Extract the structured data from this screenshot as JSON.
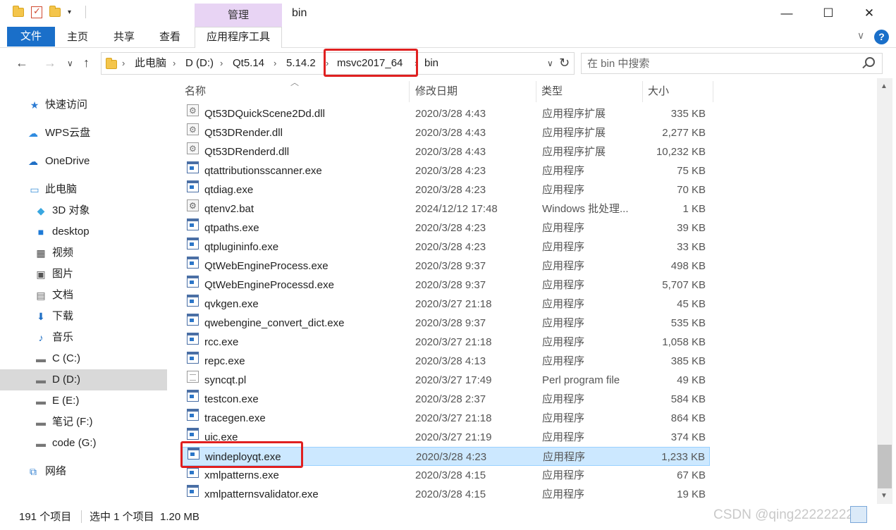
{
  "window": {
    "title": "bin",
    "contextual_group": "管理",
    "controls": {
      "minimize": "—",
      "maximize": "☐",
      "close": "✕"
    }
  },
  "ribbon": {
    "tabs": {
      "file": "文件",
      "home": "主页",
      "share": "共享",
      "view": "查看",
      "app_tools": "应用程序工具"
    },
    "help": "?",
    "expand": "∨"
  },
  "address": {
    "crumbs": [
      "此电脑",
      "D (D:)",
      "Qt5.14",
      "5.14.2",
      "msvc2017_64",
      "bin"
    ],
    "separator": "›",
    "highlighted_crumb": "msvc2017_64"
  },
  "nav": {
    "back": "←",
    "forward": "→",
    "recent": "∨",
    "up": "↑",
    "refresh": "↻"
  },
  "search": {
    "placeholder": "在 bin 中搜索"
  },
  "sidebar": {
    "items": [
      {
        "label": "快速访问",
        "icon": "star-icon"
      },
      {
        "label": "WPS云盘",
        "icon": "cloud-icon"
      },
      {
        "label": "OneDrive",
        "icon": "cloud-icon"
      },
      {
        "label": "此电脑",
        "icon": "computer-icon"
      },
      {
        "label": "3D 对象",
        "icon": "cube-icon"
      },
      {
        "label": "desktop",
        "icon": "desktop-icon"
      },
      {
        "label": "视频",
        "icon": "film-icon"
      },
      {
        "label": "图片",
        "icon": "picture-icon"
      },
      {
        "label": "文档",
        "icon": "document-icon"
      },
      {
        "label": "下载",
        "icon": "download-icon"
      },
      {
        "label": "音乐",
        "icon": "music-icon"
      },
      {
        "label": "C (C:)",
        "icon": "drive-icon"
      },
      {
        "label": "D (D:)",
        "icon": "drive-icon"
      },
      {
        "label": "E (E:)",
        "icon": "drive-icon"
      },
      {
        "label": "笔记 (F:)",
        "icon": "drive-icon"
      },
      {
        "label": "code (G:)",
        "icon": "drive-icon"
      },
      {
        "label": "网络",
        "icon": "network-icon"
      }
    ],
    "selected": "D (D:)"
  },
  "columns": {
    "name": "名称",
    "date": "修改日期",
    "type": "类型",
    "size": "大小"
  },
  "files": [
    {
      "name": "Qt53DQuickScene2Dd.dll",
      "date": "2020/3/28 4:43",
      "type": "应用程序扩展",
      "size": "335 KB",
      "icon": "dll-file-icon"
    },
    {
      "name": "Qt53DRender.dll",
      "date": "2020/3/28 4:43",
      "type": "应用程序扩展",
      "size": "2,277 KB",
      "icon": "dll-file-icon"
    },
    {
      "name": "Qt53DRenderd.dll",
      "date": "2020/3/28 4:43",
      "type": "应用程序扩展",
      "size": "10,232 KB",
      "icon": "dll-file-icon"
    },
    {
      "name": "qtattributionsscanner.exe",
      "date": "2020/3/28 4:23",
      "type": "应用程序",
      "size": "75 KB",
      "icon": "exe-file-icon"
    },
    {
      "name": "qtdiag.exe",
      "date": "2020/3/28 4:23",
      "type": "应用程序",
      "size": "70 KB",
      "icon": "exe-file-icon"
    },
    {
      "name": "qtenv2.bat",
      "date": "2024/12/12 17:48",
      "type": "Windows 批处理...",
      "size": "1 KB",
      "icon": "bat-file-icon"
    },
    {
      "name": "qtpaths.exe",
      "date": "2020/3/28 4:23",
      "type": "应用程序",
      "size": "39 KB",
      "icon": "exe-file-icon"
    },
    {
      "name": "qtplugininfo.exe",
      "date": "2020/3/28 4:23",
      "type": "应用程序",
      "size": "33 KB",
      "icon": "exe-file-icon"
    },
    {
      "name": "QtWebEngineProcess.exe",
      "date": "2020/3/28 9:37",
      "type": "应用程序",
      "size": "498 KB",
      "icon": "exe-file-icon"
    },
    {
      "name": "QtWebEngineProcessd.exe",
      "date": "2020/3/28 9:37",
      "type": "应用程序",
      "size": "5,707 KB",
      "icon": "exe-file-icon"
    },
    {
      "name": "qvkgen.exe",
      "date": "2020/3/27 21:18",
      "type": "应用程序",
      "size": "45 KB",
      "icon": "exe-file-icon"
    },
    {
      "name": "qwebengine_convert_dict.exe",
      "date": "2020/3/28 9:37",
      "type": "应用程序",
      "size": "535 KB",
      "icon": "exe-file-icon"
    },
    {
      "name": "rcc.exe",
      "date": "2020/3/27 21:18",
      "type": "应用程序",
      "size": "1,058 KB",
      "icon": "exe-file-icon"
    },
    {
      "name": "repc.exe",
      "date": "2020/3/28 4:13",
      "type": "应用程序",
      "size": "385 KB",
      "icon": "exe-file-icon"
    },
    {
      "name": "syncqt.pl",
      "date": "2020/3/27 17:49",
      "type": "Perl program file",
      "size": "49 KB",
      "icon": "text-file-icon"
    },
    {
      "name": "testcon.exe",
      "date": "2020/3/28 2:37",
      "type": "应用程序",
      "size": "584 KB",
      "icon": "exe-file-icon"
    },
    {
      "name": "tracegen.exe",
      "date": "2020/3/27 21:18",
      "type": "应用程序",
      "size": "864 KB",
      "icon": "exe-file-icon"
    },
    {
      "name": "uic.exe",
      "date": "2020/3/27 21:19",
      "type": "应用程序",
      "size": "374 KB",
      "icon": "exe-file-icon"
    },
    {
      "name": "windeployqt.exe",
      "date": "2020/3/28 4:23",
      "type": "应用程序",
      "size": "1,233 KB",
      "icon": "exe-file-icon",
      "selected": true
    },
    {
      "name": "xmlpatterns.exe",
      "date": "2020/3/28 4:15",
      "type": "应用程序",
      "size": "67 KB",
      "icon": "exe-file-icon"
    },
    {
      "name": "xmlpatternsvalidator.exe",
      "date": "2020/3/28 4:15",
      "type": "应用程序",
      "size": "19 KB",
      "icon": "exe-file-icon"
    }
  ],
  "status": {
    "item_count": "191 个项目",
    "selection": "选中 1 个项目  1.20 MB"
  },
  "watermark": "CSDN @qing22222222",
  "colors": {
    "accent": "#1a6fc9",
    "manage_tab": "#e8d4f4",
    "selection_bg": "#cce8ff",
    "selection_border": "#99d1ff",
    "annotation_red": "#e02020"
  }
}
